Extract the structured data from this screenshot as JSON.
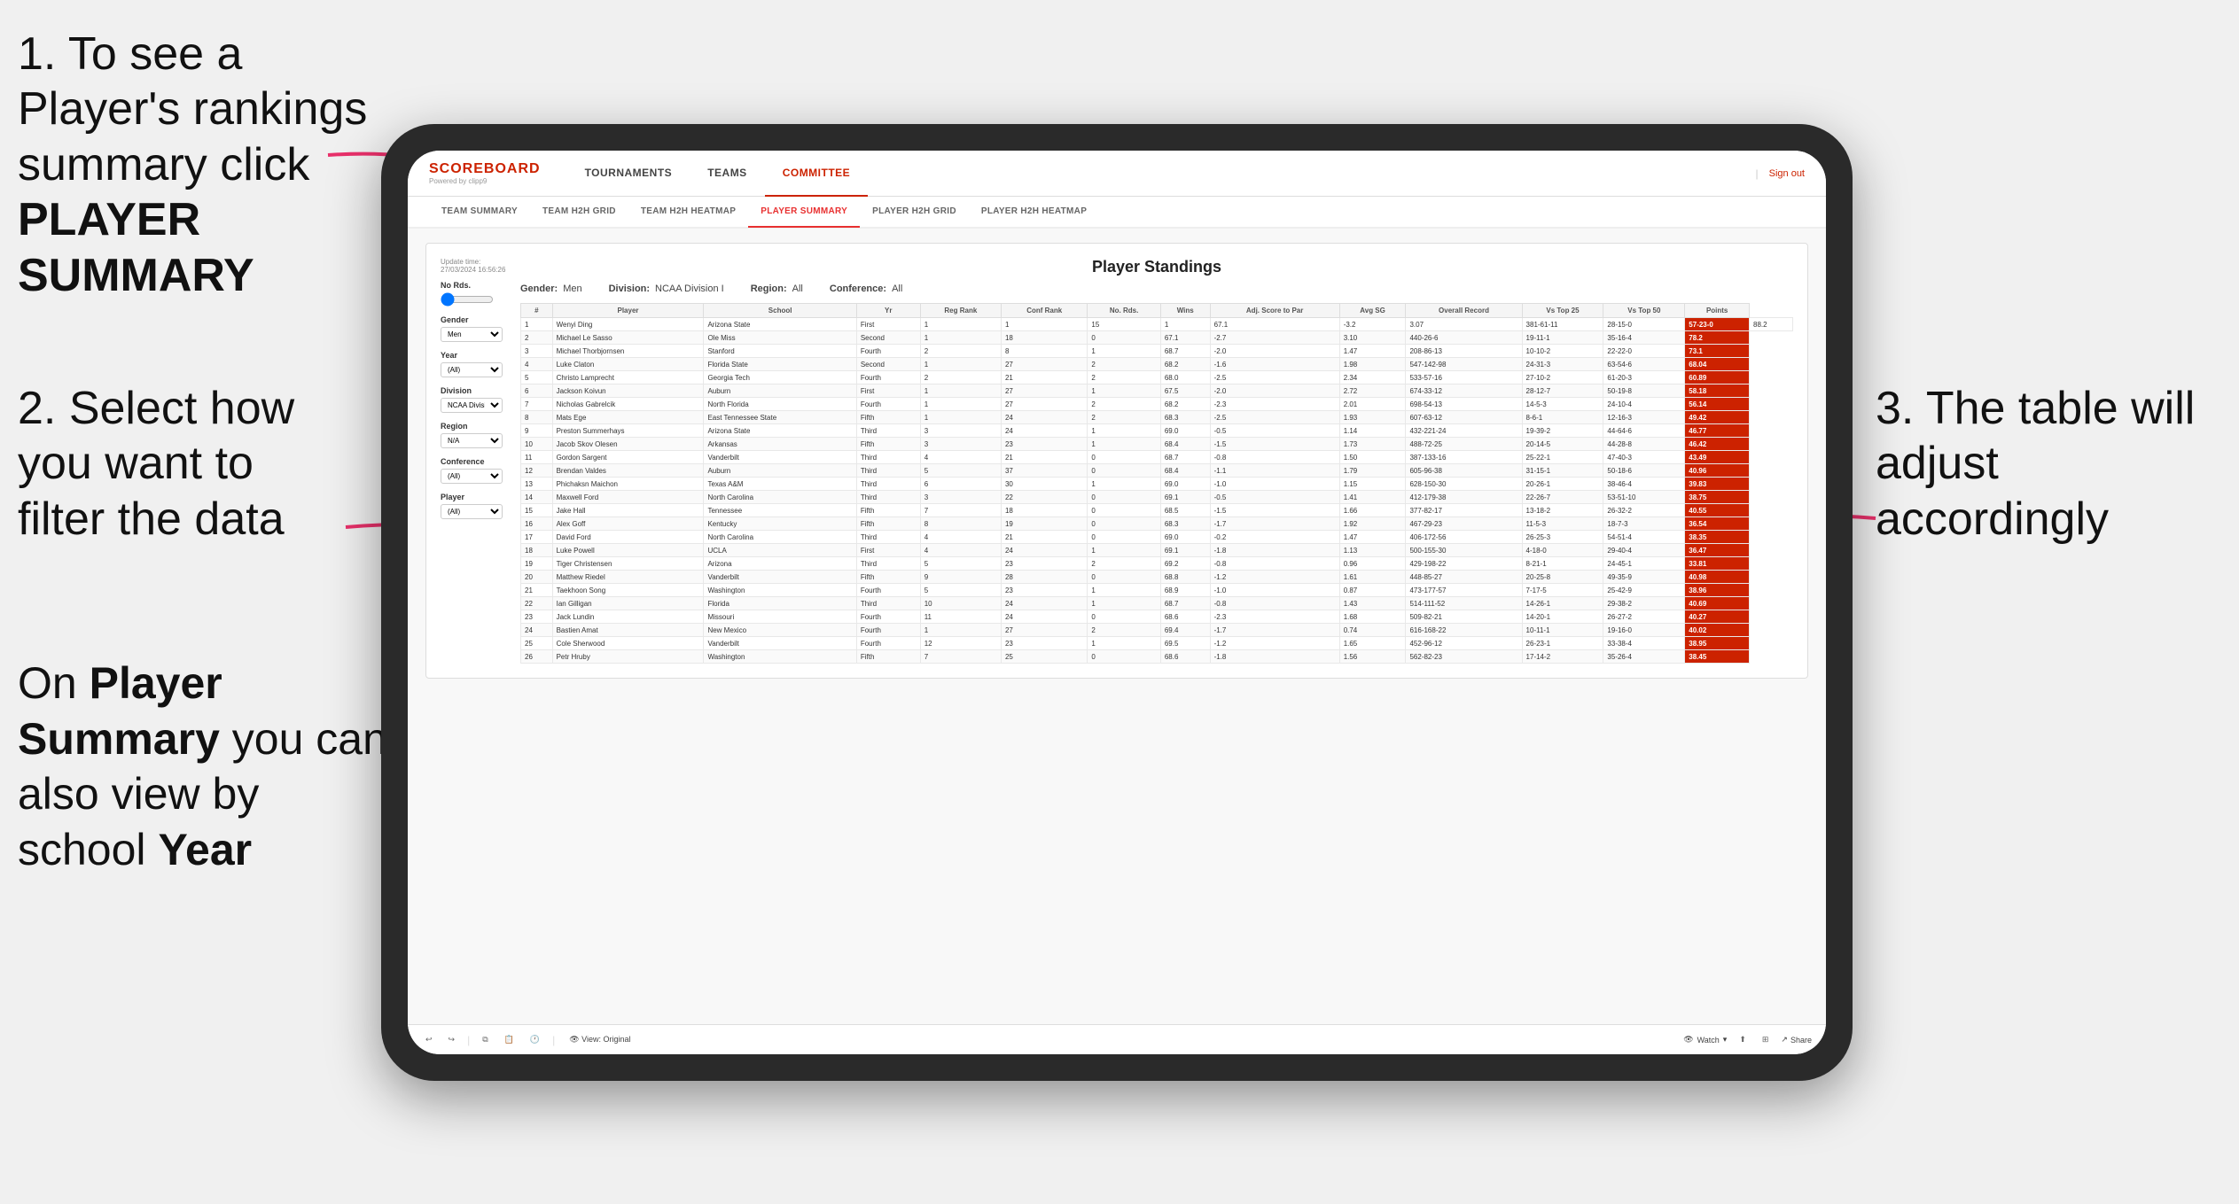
{
  "instructions": {
    "step1": "1. To see a Player's rankings summary click ",
    "step1_bold": "PLAYER SUMMARY",
    "step2_line1": "2. Select how",
    "step2_line2": "you want to",
    "step2_line3": "filter the data",
    "step3": "3. The table will adjust accordingly",
    "note_line1": "On ",
    "note_bold1": "Player",
    "note_line2": "Summary",
    "note_line3": " you can also view by school ",
    "note_bold2": "Year"
  },
  "header": {
    "logo": "SCOREBOARD",
    "logo_sub": "Powered by clipp9",
    "nav_items": [
      "TOURNAMENTS",
      "TEAMS",
      "COMMITTEE"
    ],
    "sign_out": "Sign out"
  },
  "sub_nav": {
    "items": [
      "TEAM SUMMARY",
      "TEAM H2H GRID",
      "TEAM H2H HEATMAP",
      "PLAYER SUMMARY",
      "PLAYER H2H GRID",
      "PLAYER H2H HEATMAP"
    ],
    "active": "PLAYER SUMMARY"
  },
  "standings": {
    "title": "Player Standings",
    "update_time": "Update time: 27/03/2024 16:56:26",
    "filters": {
      "gender_label": "Gender:",
      "gender_value": "Men",
      "division_label": "Division:",
      "division_value": "NCAA Division I",
      "region_label": "Region:",
      "region_value": "All",
      "conference_label": "Conference:",
      "conference_value": "All"
    },
    "controls": {
      "no_rds_label": "No Rds.",
      "gender_label": "Gender",
      "gender_value": "Men",
      "year_label": "Year",
      "year_value": "(All)",
      "division_label": "Division",
      "division_value": "NCAA Division I",
      "region_label": "Region",
      "region_value": "N/A",
      "conference_label": "Conference",
      "conference_value": "(All)",
      "player_label": "Player",
      "player_value": "(All)"
    },
    "table_headers": [
      "#",
      "Player",
      "School",
      "Yr",
      "Reg Rank",
      "Conf Rank",
      "No. Rds.",
      "Wins",
      "Adj. Score to Par",
      "Avg SG",
      "Overall Record",
      "Vs Top 25",
      "Vs Top 50",
      "Points"
    ],
    "rows": [
      [
        "1",
        "Wenyi Ding",
        "Arizona State",
        "First",
        "1",
        "1",
        "15",
        "1",
        "67.1",
        "-3.2",
        "3.07",
        "381-61-11",
        "28-15-0",
        "57-23-0",
        "88.2"
      ],
      [
        "2",
        "Michael Le Sasso",
        "Ole Miss",
        "Second",
        "1",
        "18",
        "0",
        "67.1",
        "-2.7",
        "3.10",
        "440-26-6",
        "19-11-1",
        "35-16-4",
        "78.2"
      ],
      [
        "3",
        "Michael Thorbjornsen",
        "Stanford",
        "Fourth",
        "2",
        "8",
        "1",
        "68.7",
        "-2.0",
        "1.47",
        "208-86-13",
        "10-10-2",
        "22-22-0",
        "73.1"
      ],
      [
        "4",
        "Luke Claton",
        "Florida State",
        "Second",
        "1",
        "27",
        "2",
        "68.2",
        "-1.6",
        "1.98",
        "547-142-98",
        "24-31-3",
        "63-54-6",
        "68.04"
      ],
      [
        "5",
        "Christo Lamprecht",
        "Georgia Tech",
        "Fourth",
        "2",
        "21",
        "2",
        "68.0",
        "-2.5",
        "2.34",
        "533-57-16",
        "27-10-2",
        "61-20-3",
        "60.89"
      ],
      [
        "6",
        "Jackson Koivun",
        "Auburn",
        "First",
        "1",
        "27",
        "1",
        "67.5",
        "-2.0",
        "2.72",
        "674-33-12",
        "28-12-7",
        "50-19-8",
        "58.18"
      ],
      [
        "7",
        "Nicholas Gabrelcik",
        "North Florida",
        "Fourth",
        "1",
        "27",
        "2",
        "68.2",
        "-2.3",
        "2.01",
        "698-54-13",
        "14-5-3",
        "24-10-4",
        "56.14"
      ],
      [
        "8",
        "Mats Ege",
        "East Tennessee State",
        "Fifth",
        "1",
        "24",
        "2",
        "68.3",
        "-2.5",
        "1.93",
        "607-63-12",
        "8-6-1",
        "12-16-3",
        "49.42"
      ],
      [
        "9",
        "Preston Summerhays",
        "Arizona State",
        "Third",
        "3",
        "24",
        "1",
        "69.0",
        "-0.5",
        "1.14",
        "432-221-24",
        "19-39-2",
        "44-64-6",
        "46.77"
      ],
      [
        "10",
        "Jacob Skov Olesen",
        "Arkansas",
        "Fifth",
        "3",
        "23",
        "1",
        "68.4",
        "-1.5",
        "1.73",
        "488-72-25",
        "20-14-5",
        "44-28-8",
        "46.42"
      ],
      [
        "11",
        "Gordon Sargent",
        "Vanderbilt",
        "Third",
        "4",
        "21",
        "0",
        "68.7",
        "-0.8",
        "1.50",
        "387-133-16",
        "25-22-1",
        "47-40-3",
        "43.49"
      ],
      [
        "12",
        "Brendan Valdes",
        "Auburn",
        "Third",
        "5",
        "37",
        "0",
        "68.4",
        "-1.1",
        "1.79",
        "605-96-38",
        "31-15-1",
        "50-18-6",
        "40.96"
      ],
      [
        "13",
        "Phichaksn Maichon",
        "Texas A&M",
        "Third",
        "6",
        "30",
        "1",
        "69.0",
        "-1.0",
        "1.15",
        "628-150-30",
        "20-26-1",
        "38-46-4",
        "39.83"
      ],
      [
        "14",
        "Maxwell Ford",
        "North Carolina",
        "Third",
        "3",
        "22",
        "0",
        "69.1",
        "-0.5",
        "1.41",
        "412-179-38",
        "22-26-7",
        "53-51-10",
        "38.75"
      ],
      [
        "15",
        "Jake Hall",
        "Tennessee",
        "Fifth",
        "7",
        "18",
        "0",
        "68.5",
        "-1.5",
        "1.66",
        "377-82-17",
        "13-18-2",
        "26-32-2",
        "40.55"
      ],
      [
        "16",
        "Alex Goff",
        "Kentucky",
        "Fifth",
        "8",
        "19",
        "0",
        "68.3",
        "-1.7",
        "1.92",
        "467-29-23",
        "11-5-3",
        "18-7-3",
        "36.54"
      ],
      [
        "17",
        "David Ford",
        "North Carolina",
        "Third",
        "4",
        "21",
        "0",
        "69.0",
        "-0.2",
        "1.47",
        "406-172-56",
        "26-25-3",
        "54-51-4",
        "38.35"
      ],
      [
        "18",
        "Luke Powell",
        "UCLA",
        "First",
        "4",
        "24",
        "1",
        "69.1",
        "-1.8",
        "1.13",
        "500-155-30",
        "4-18-0",
        "29-40-4",
        "36.47"
      ],
      [
        "19",
        "Tiger Christensen",
        "Arizona",
        "Third",
        "5",
        "23",
        "2",
        "69.2",
        "-0.8",
        "0.96",
        "429-198-22",
        "8-21-1",
        "24-45-1",
        "33.81"
      ],
      [
        "20",
        "Matthew Riedel",
        "Vanderbilt",
        "Fifth",
        "9",
        "28",
        "0",
        "68.8",
        "-1.2",
        "1.61",
        "448-85-27",
        "20-25-8",
        "49-35-9",
        "40.98"
      ],
      [
        "21",
        "Taekhoon Song",
        "Washington",
        "Fourth",
        "5",
        "23",
        "1",
        "68.9",
        "-1.0",
        "0.87",
        "473-177-57",
        "7-17-5",
        "25-42-9",
        "38.96"
      ],
      [
        "22",
        "Ian Gilligan",
        "Florida",
        "Third",
        "10",
        "24",
        "1",
        "68.7",
        "-0.8",
        "1.43",
        "514-111-52",
        "14-26-1",
        "29-38-2",
        "40.69"
      ],
      [
        "23",
        "Jack Lundin",
        "Missouri",
        "Fourth",
        "11",
        "24",
        "0",
        "68.6",
        "-2.3",
        "1.68",
        "509-82-21",
        "14-20-1",
        "26-27-2",
        "40.27"
      ],
      [
        "24",
        "Bastien Amat",
        "New Mexico",
        "Fourth",
        "1",
        "27",
        "2",
        "69.4",
        "-1.7",
        "0.74",
        "616-168-22",
        "10-11-1",
        "19-16-0",
        "40.02"
      ],
      [
        "25",
        "Cole Sherwood",
        "Vanderbilt",
        "Fourth",
        "12",
        "23",
        "1",
        "69.5",
        "-1.2",
        "1.65",
        "452-96-12",
        "26-23-1",
        "33-38-4",
        "38.95"
      ],
      [
        "26",
        "Petr Hruby",
        "Washington",
        "Fifth",
        "7",
        "25",
        "0",
        "68.6",
        "-1.8",
        "1.56",
        "562-82-23",
        "17-14-2",
        "35-26-4",
        "38.45"
      ]
    ]
  },
  "toolbar": {
    "undo": "↩",
    "redo": "↪",
    "view": "View: Original",
    "watch": "Watch",
    "share": "Share"
  }
}
